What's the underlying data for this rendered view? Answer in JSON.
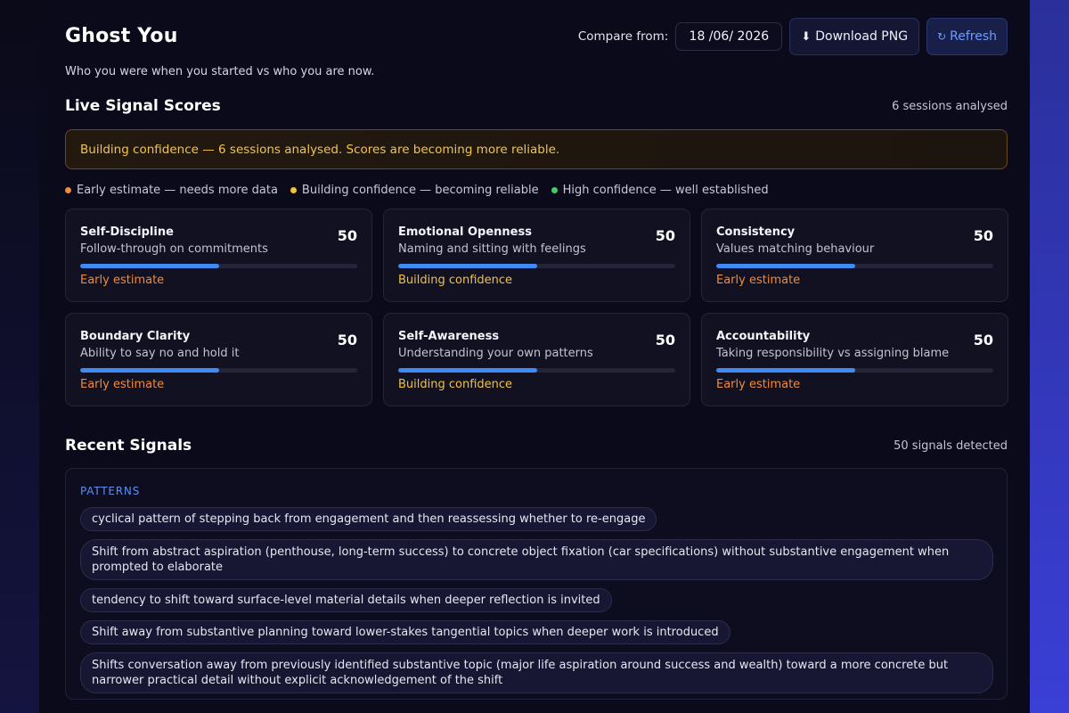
{
  "header": {
    "title": "Ghost You",
    "subtitle": "Who you were when you started vs who you are now.",
    "compare_label": "Compare from:",
    "compare_date": "18 /06/ 2026",
    "download_label": "Download PNG",
    "download_icon": "download-icon",
    "refresh_label": "Refresh",
    "refresh_icon": "refresh-icon"
  },
  "live_scores": {
    "title": "Live Signal Scores",
    "meta": "6 sessions analysed",
    "banner": "Building confidence — 6 sessions analysed. Scores are becoming more reliable.",
    "legend": [
      {
        "label": "Early estimate — needs more data",
        "color": "#f08a3c"
      },
      {
        "label": "Building confidence — becoming reliable",
        "color": "#f2c23a"
      },
      {
        "label": "High confidence — well established",
        "color": "#3ccf6a"
      }
    ],
    "cards": [
      {
        "name": "Self-Discipline",
        "desc": "Follow-through on commitments",
        "score": "50",
        "fill": 0.5,
        "confidence": "Early estimate",
        "color": "#f08a3c"
      },
      {
        "name": "Emotional Openness",
        "desc": "Naming and sitting with feelings",
        "score": "50",
        "fill": 0.5,
        "confidence": "Building confidence",
        "color": "#f2c23a"
      },
      {
        "name": "Consistency",
        "desc": "Values matching behaviour",
        "score": "50",
        "fill": 0.5,
        "confidence": "Early estimate",
        "color": "#f08a3c"
      },
      {
        "name": "Boundary Clarity",
        "desc": "Ability to say no and hold it",
        "score": "50",
        "fill": 0.5,
        "confidence": "Early estimate",
        "color": "#f08a3c"
      },
      {
        "name": "Self-Awareness",
        "desc": "Understanding your own patterns",
        "score": "50",
        "fill": 0.5,
        "confidence": "Building confidence",
        "color": "#f2c23a"
      },
      {
        "name": "Accountability",
        "desc": "Taking responsibility vs assigning blame",
        "score": "50",
        "fill": 0.5,
        "confidence": "Early estimate",
        "color": "#f08a3c"
      }
    ]
  },
  "recent_signals": {
    "title": "Recent Signals",
    "meta": "50 signals detected",
    "category": "PATTERNS",
    "items": [
      "cyclical pattern of stepping back from engagement and then reassessing whether to re-engage",
      "Shift from abstract aspiration (penthouse, long-term success) to concrete object fixation (car specifications) without substantive engagement when prompted to elaborate",
      "tendency to shift toward surface-level material details when deeper reflection is invited",
      "Shift away from substantive planning toward lower-stakes tangential topics when deeper work is introduced",
      "Shifts conversation away from previously identified substantive topic (major life aspiration around success and wealth) toward a more concrete but narrower practical detail without explicit acknowledgement of the shift"
    ]
  }
}
